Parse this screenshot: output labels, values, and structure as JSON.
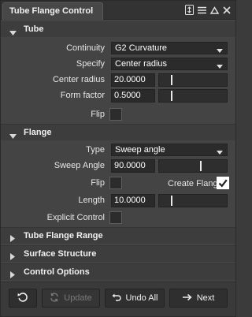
{
  "window": {
    "title": "Tube Flange Control"
  },
  "sections": {
    "tube": {
      "title": "Tube",
      "continuity_label": "Continuity",
      "continuity_value": "G2 Curvature",
      "specify_label": "Specify",
      "specify_value": "Center radius",
      "center_radius_label": "Center radius",
      "center_radius_value": "20.0000",
      "center_radius_level": 0.18,
      "form_factor_label": "Form factor",
      "form_factor_value": "0.5000",
      "form_factor_level": 0.18,
      "flip_label": "Flip",
      "flip_checked": false
    },
    "flange": {
      "title": "Flange",
      "type_label": "Type",
      "type_value": "Sweep angle",
      "sweep_angle_label": "Sweep Angle",
      "sweep_angle_value": "90.0000",
      "sweep_angle_level": 0.62,
      "flip_label": "Flip",
      "flip_checked": false,
      "create_flange_label": "Create Flange",
      "create_flange_checked": true,
      "length_label": "Length",
      "length_value": "10.0000",
      "length_level": 0.18,
      "explicit_control_label": "Explicit Control",
      "explicit_control_checked": false
    },
    "collapsed": [
      {
        "title": "Tube Flange Range"
      },
      {
        "title": "Surface Structure"
      },
      {
        "title": "Control Options"
      }
    ]
  },
  "footer": {
    "reset_icon": "reset-icon",
    "update_label": "Update",
    "undo_all_label": "Undo All",
    "next_label": "Next"
  },
  "icons": {
    "titlebar": [
      "pin-icon",
      "menu-icon",
      "collapse-up-icon",
      "close-icon"
    ]
  }
}
